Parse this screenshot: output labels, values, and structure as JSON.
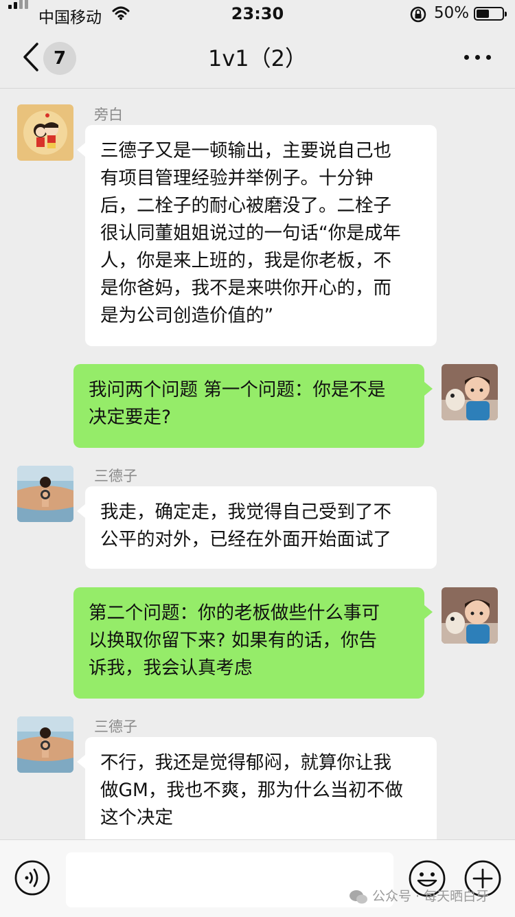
{
  "status_bar": {
    "carrier": "中国移动",
    "time": "23:30",
    "battery": "50%",
    "battery_level": 0.5
  },
  "nav": {
    "back_count": "7",
    "title": "1v1（2）"
  },
  "messages": [
    {
      "side": "left",
      "sender": "旁白",
      "avatar": "crayon-shin-chan-avatar",
      "text": "三德子又是一顿输出，主要说自己也\n有项目管理经验并举例子。十分钟\n后，二栓子的耐心被磨没了。二栓子\n很认同董姐姐说过的一句话“你是成年\n人，你是来上班的，我是你老板，不\n是你爸妈，我不是来哄你开心的，而\n是为公司创造价值的”"
    },
    {
      "side": "right",
      "avatar": "boy-with-dog-avatar",
      "text": "我问两个问题 第一个问题：你是不是\n决定要走?"
    },
    {
      "side": "left",
      "sender": "三德子",
      "avatar": "ace-back-avatar",
      "text": "我走，确定走，我觉得自己受到了不\n公平的对外，已经在外面开始面试了"
    },
    {
      "side": "right",
      "avatar": "boy-with-dog-avatar",
      "text": "第二个问题：你的老板做些什么事可\n以换取你留下来? 如果有的话，你告\n诉我，我会认真考虑"
    },
    {
      "side": "left",
      "sender": "三德子",
      "avatar": "ace-back-avatar",
      "text": "不行，我还是觉得郁闷，就算你让我\n做GM，我也不爽，那为什么当初不做\n这个决定"
    }
  ],
  "input": {
    "value": "",
    "placeholder": ""
  },
  "watermark": "公众号 · 每天晒白牙",
  "colors": {
    "background": "#ededed",
    "bubble_self": "#95ec69",
    "bubble_other": "#ffffff",
    "sender_name": "#8a8a8a"
  }
}
